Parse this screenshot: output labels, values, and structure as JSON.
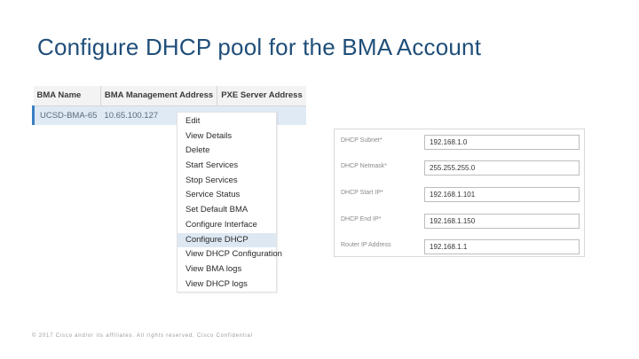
{
  "slide": {
    "title": "Configure DHCP pool for the BMA Account",
    "footer": "© 2017 Cisco and/or its affiliates. All rights reserved.   Cisco Confidential"
  },
  "bma_table": {
    "columns": [
      "BMA Name",
      "BMA Management Address",
      "PXE Server Address"
    ],
    "rows": [
      [
        "UCSD-BMA-65",
        "10.65.100.127",
        ""
      ]
    ]
  },
  "context_menu": {
    "items": [
      "Edit",
      "View Details",
      "Delete",
      "Start Services",
      "Stop Services",
      "Service Status",
      "Set Default BMA",
      "Configure Interface",
      "Configure DHCP",
      "View DHCP Configuration",
      "View BMA logs",
      "View DHCP logs"
    ],
    "active_item": "Configure DHCP"
  },
  "dhcp_form": {
    "subnet": {
      "label": "DHCP Subnet*",
      "value": "192.168.1.0"
    },
    "netmask": {
      "label": "DHCP Netmask*",
      "value": "255.255.255.0"
    },
    "start_ip": {
      "label": "DHCP Start IP*",
      "value": "192.168.1.101"
    },
    "end_ip": {
      "label": "DHCP End IP*",
      "value": "192.168.1.150"
    },
    "router_ip": {
      "label": "Router IP Address",
      "value": "192.168.1.1"
    }
  }
}
